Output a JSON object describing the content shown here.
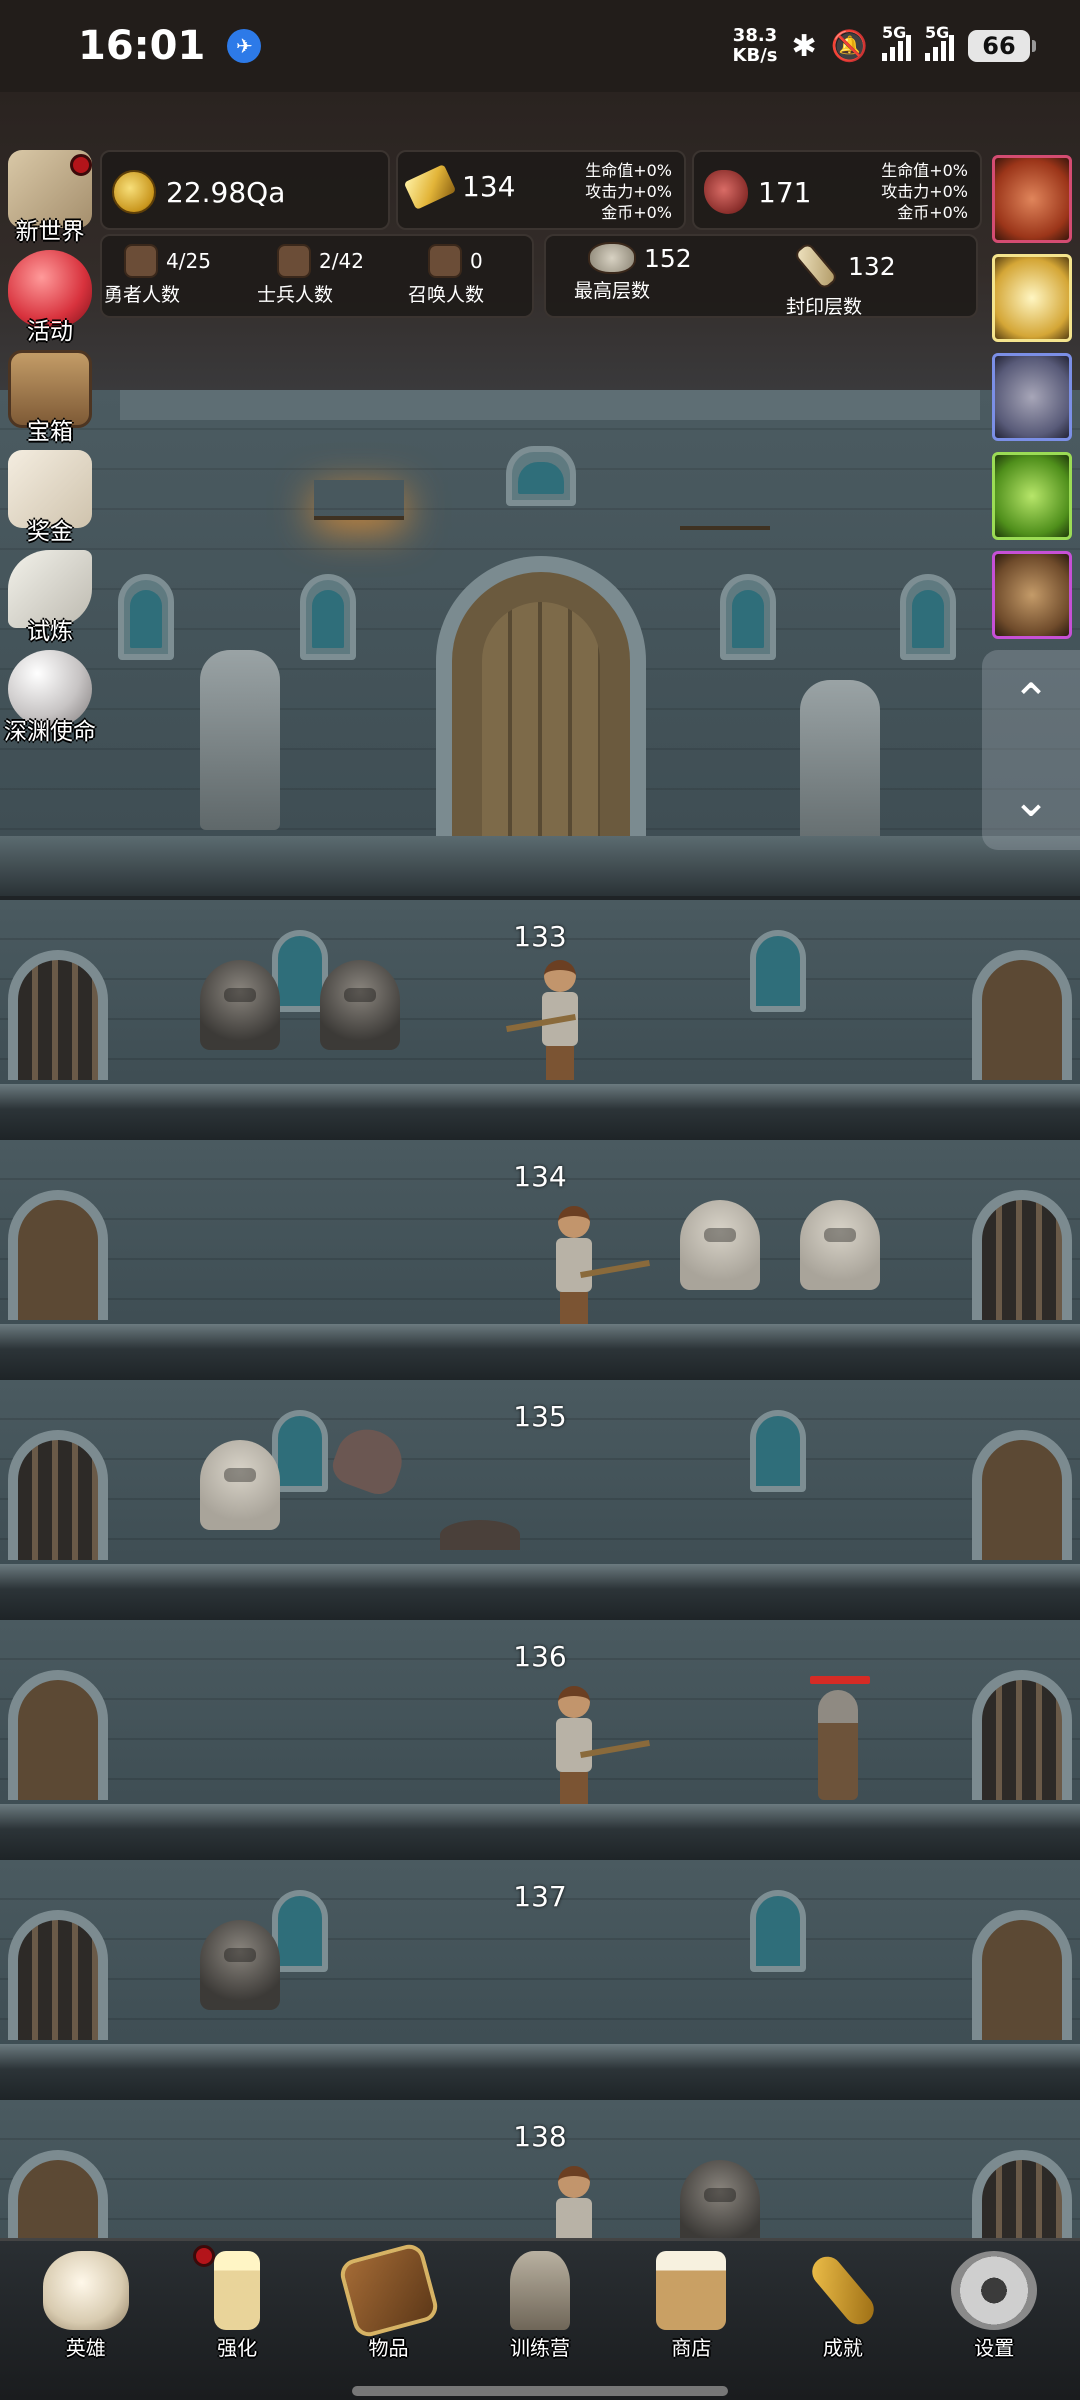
{
  "status_bar": {
    "time": "16:01",
    "net_speed_value": "38.3",
    "net_speed_unit": "KB/s",
    "signal_1": "5G",
    "signal_2": "5G",
    "battery": "66",
    "icons": [
      "notification-app-icon",
      "bluetooth-icon",
      "mute-bell-icon",
      "signal-icon",
      "signal-icon",
      "battery-icon"
    ]
  },
  "resources": {
    "gold": {
      "value": "22.98Qa",
      "icon": "gold-coin-icon"
    },
    "gold_bar": {
      "value": "134",
      "icon": "gold-bar-icon",
      "bonus": [
        "生命值+0%",
        "攻击力+0%",
        "金币+0%"
      ]
    },
    "meat": {
      "value": "171",
      "icon": "meat-icon",
      "bonus": [
        "生命值+0%",
        "攻击力+0%",
        "金币+0%"
      ]
    }
  },
  "stats": {
    "heroes": {
      "value": "4/25",
      "label": "勇者人数"
    },
    "soldiers": {
      "value": "2/42",
      "label": "士兵人数"
    },
    "summons": {
      "value": "0",
      "label": "召唤人数"
    },
    "highest_floor": {
      "value": "152",
      "label": "最高层数"
    },
    "sealed_floor": {
      "value": "132",
      "label": "封印层数"
    }
  },
  "left_menu": [
    {
      "label": "新世界",
      "icon": "map-icon",
      "badge": true
    },
    {
      "label": "活动",
      "icon": "heart-icon",
      "badge": false
    },
    {
      "label": "宝箱",
      "icon": "chest-icon",
      "badge": false
    },
    {
      "label": "奖金",
      "icon": "envelope-icon",
      "badge": false
    },
    {
      "label": "试炼",
      "icon": "feather-icon",
      "badge": false
    },
    {
      "label": "深渊使命",
      "icon": "pearl-icon",
      "badge": false
    }
  ],
  "right_menu": [
    {
      "icon": "pumpkin-boss-icon"
    },
    {
      "icon": "candle-boss-icon"
    },
    {
      "icon": "armor-boss-icon"
    },
    {
      "icon": "slime-boss-icon"
    },
    {
      "icon": "goblin-boss-icon"
    }
  ],
  "scroll_controls": {
    "up": "⌃",
    "down": "⌄"
  },
  "floors": [
    "133",
    "134",
    "135",
    "136",
    "137",
    "138"
  ],
  "bottom_nav": [
    {
      "label": "英雄",
      "icon": "skull-icon",
      "badge": false
    },
    {
      "label": "强化",
      "icon": "candle-icon",
      "badge": true
    },
    {
      "label": "物品",
      "icon": "book-icon",
      "badge": false
    },
    {
      "label": "训练营",
      "icon": "lantern-icon",
      "badge": false
    },
    {
      "label": "商店",
      "icon": "beer-mug-icon",
      "badge": false
    },
    {
      "label": "成就",
      "icon": "key-icon",
      "badge": false
    },
    {
      "label": "设置",
      "icon": "gear-icon",
      "badge": false
    }
  ],
  "colors": {
    "badge_red": "#b3141a",
    "hp_red": "#d62b25",
    "stone": "#4a5a60"
  }
}
